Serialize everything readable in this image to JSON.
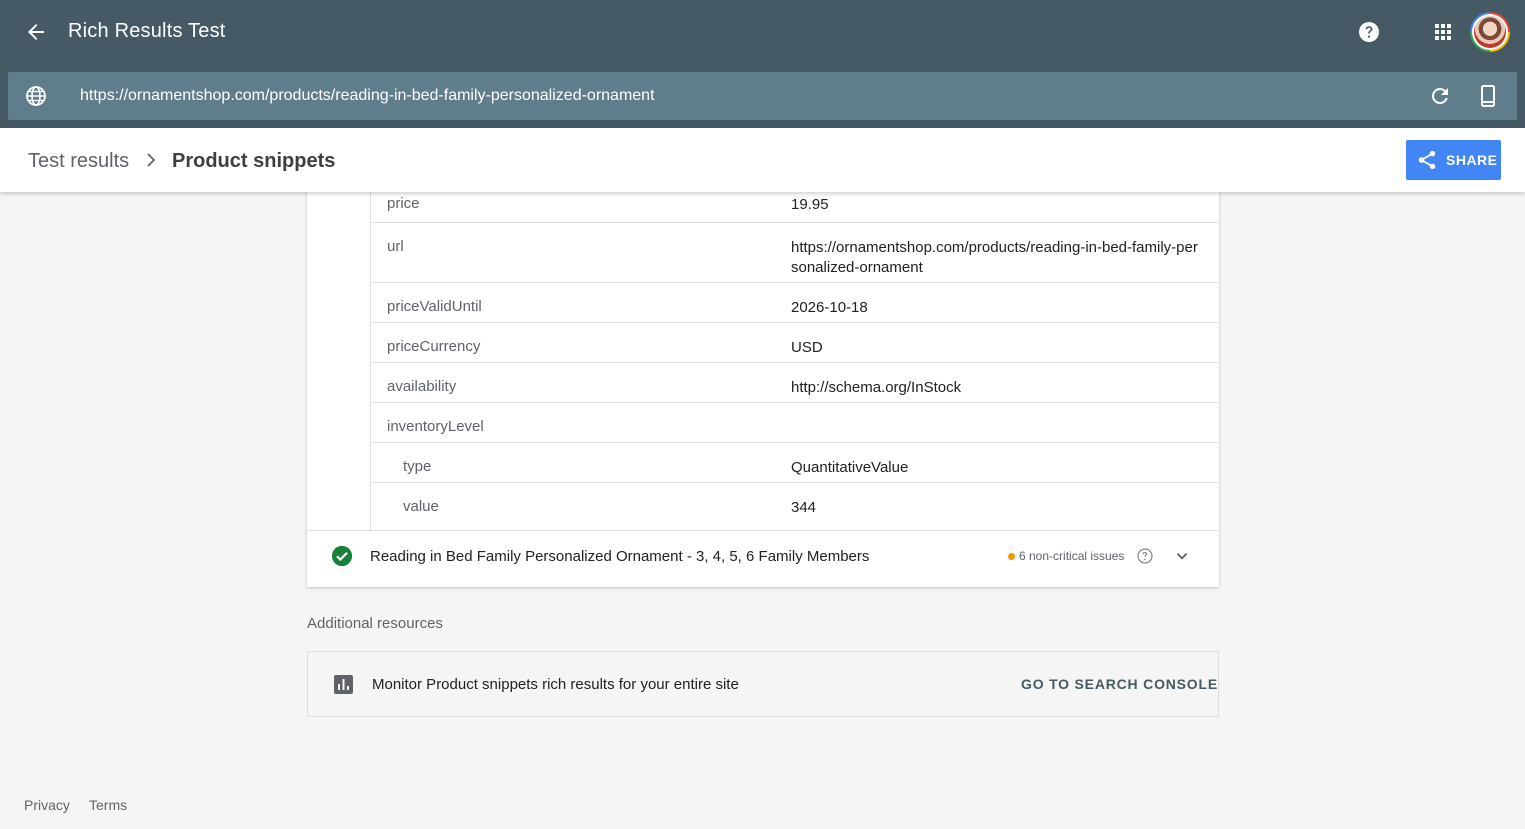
{
  "header": {
    "app_title": "Rich Results Test",
    "icons": [
      "back-arrow-icon",
      "help-icon",
      "apps-grid-icon",
      "account-avatar"
    ]
  },
  "url_bar": {
    "url": "https://ornamentshop.com/products/reading-in-bed-family-personalized-ornament",
    "icons": [
      "globe-icon",
      "reload-icon",
      "mobile-device-icon"
    ]
  },
  "breadcrumb": {
    "root": "Test results",
    "current": "Product snippets"
  },
  "share_button": {
    "label": "SHARE"
  },
  "properties": [
    {
      "key": "price",
      "value": "19.95",
      "indent": 0
    },
    {
      "key": "url",
      "value": "https://ornamentshop.com/products/reading-in-bed-family-personalized-ornament",
      "indent": 0
    },
    {
      "key": "priceValidUntil",
      "value": "2026-10-18",
      "indent": 0
    },
    {
      "key": "priceCurrency",
      "value": "USD",
      "indent": 0
    },
    {
      "key": "availability",
      "value": "http://schema.org/InStock",
      "indent": 0
    },
    {
      "key": "inventoryLevel",
      "value": "",
      "indent": 0
    },
    {
      "key": "type",
      "value": "QuantitativeValue",
      "indent": 1
    },
    {
      "key": "value",
      "value": "344",
      "indent": 1
    }
  ],
  "detected_item": {
    "title": "Reading in Bed Family Personalized Ornament - 3, 4, 5, 6 Family Members",
    "issues": "6 non-critical issues",
    "status_color": "#188038",
    "issue_color": "#f29900"
  },
  "resources": {
    "heading": "Additional resources",
    "text": "Monitor Product snippets rich results for your entire site",
    "link": "GO TO SEARCH CONSOLE"
  },
  "footer": {
    "privacy": "Privacy",
    "terms": "Terms"
  },
  "colors": {
    "header_bg": "#455a64",
    "url_bar_bg": "#607d8b",
    "accent": "#4285f4"
  }
}
